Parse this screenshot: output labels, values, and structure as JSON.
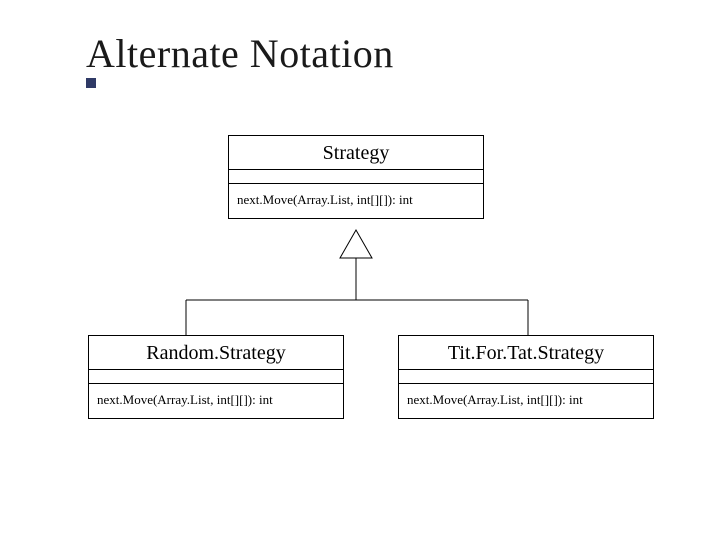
{
  "slide": {
    "title": "Alternate Notation"
  },
  "chart_data": {
    "type": "table",
    "title": "UML class diagram — generalization (inheritance)",
    "parent": {
      "name": "Strategy",
      "attributes": [],
      "operations": [
        "next.Move(Array.List, int[][]): int"
      ]
    },
    "children": [
      {
        "name": "Random.Strategy",
        "attributes": [],
        "operations": [
          "next.Move(Array.List, int[][]): int"
        ]
      },
      {
        "name": "Tit.For.Tat.Strategy",
        "attributes": [],
        "operations": [
          "next.Move(Array.List, int[][]): int"
        ]
      }
    ]
  }
}
